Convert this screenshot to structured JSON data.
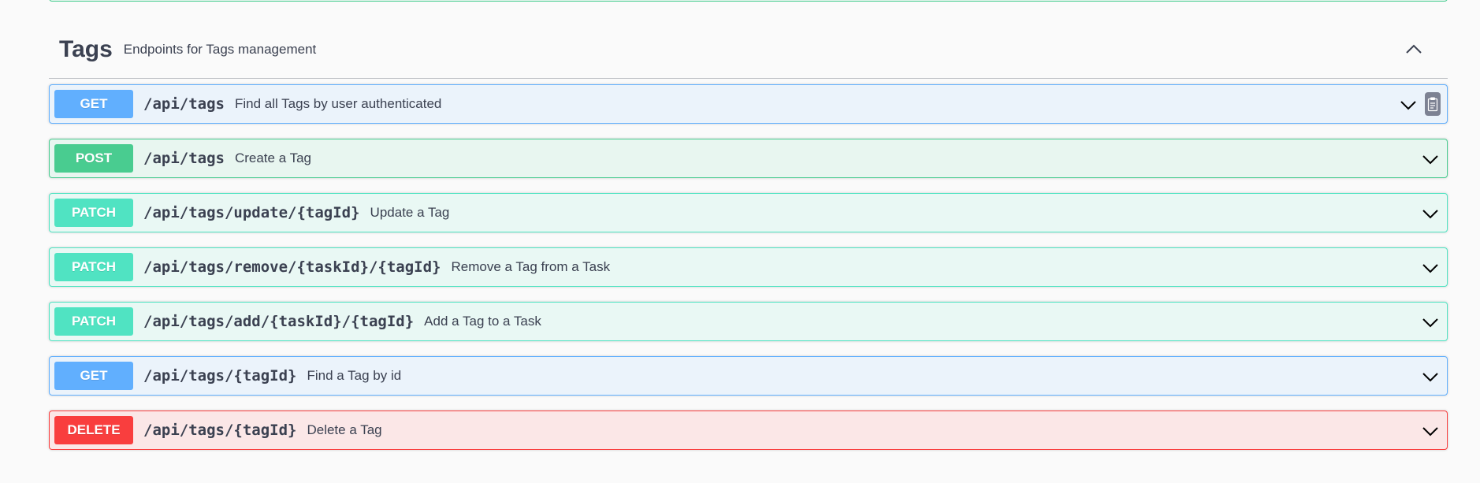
{
  "tag": {
    "title": "Tags",
    "description": "Endpoints for Tags management",
    "toggle_icon": "chevron-up-icon"
  },
  "operations": [
    {
      "method": "GET",
      "path": "/api/tags",
      "summary": "Find all Tags by user authenticated"
    },
    {
      "method": "POST",
      "path": "/api/tags",
      "summary": "Create a Tag"
    },
    {
      "method": "PATCH",
      "path": "/api/tags/update/{tagId}",
      "summary": "Update a Tag"
    },
    {
      "method": "PATCH",
      "path": "/api/tags/remove/{taskId}/{tagId}",
      "summary": "Remove a Tag from a Task"
    },
    {
      "method": "PATCH",
      "path": "/api/tags/add/{taskId}/{tagId}",
      "summary": "Add a Tag to a Task"
    },
    {
      "method": "GET",
      "path": "/api/tags/{tagId}",
      "summary": "Find a Tag by id"
    },
    {
      "method": "DELETE",
      "path": "/api/tags/{tagId}",
      "summary": "Delete a Tag"
    }
  ],
  "colors": {
    "get": "#61affe",
    "post": "#49cc90",
    "patch": "#50e3c2",
    "delete": "#f93e3e",
    "text": "#3b4151"
  },
  "icons": {
    "expand": "chevron-down-icon",
    "copy": "clipboard-icon"
  }
}
